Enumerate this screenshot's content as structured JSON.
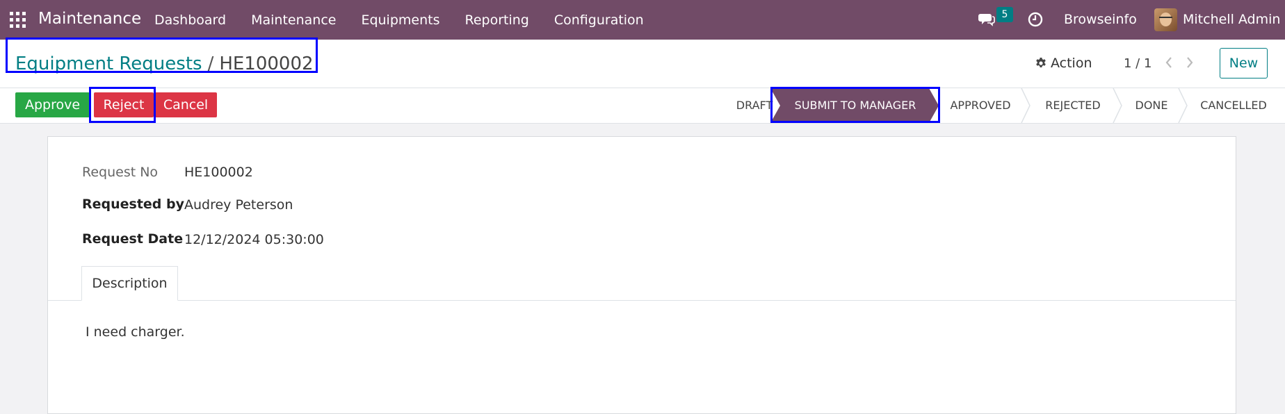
{
  "navbar": {
    "brand": "Maintenance",
    "menu": [
      "Dashboard",
      "Maintenance",
      "Equipments",
      "Reporting",
      "Configuration"
    ],
    "chat_count": "5",
    "company": "Browseinfo",
    "user": "Mitchell Admin",
    "bg_color": "#714b67"
  },
  "breadcrumb": {
    "parent": "Equipment Requests",
    "separator": "/",
    "current": "HE100002"
  },
  "control": {
    "action_label": "Action",
    "pager": "1 / 1",
    "new_label": "New"
  },
  "buttons": {
    "approve": "Approve",
    "reject": "Reject",
    "cancel": "Cancel"
  },
  "stages": [
    {
      "label": "DRAFT",
      "active": false
    },
    {
      "label": "SUBMIT TO MANAGER",
      "active": true
    },
    {
      "label": "APPROVED",
      "active": false
    },
    {
      "label": "REJECTED",
      "active": false
    },
    {
      "label": "DONE",
      "active": false
    },
    {
      "label": "CANCELLED",
      "active": false
    }
  ],
  "form": {
    "request_no_label": "Request No",
    "request_no": "HE100002",
    "requested_by_label": "Requested by",
    "requested_by": "Audrey Peterson",
    "request_date_label": "Request Date",
    "request_date": "12/12/2024 05:30:00",
    "tab_label": "Description",
    "description": "I need charger."
  },
  "colors": {
    "accent": "#017e84",
    "approve": "#28a745",
    "danger": "#dc3545",
    "highlight": "#0000ff"
  }
}
